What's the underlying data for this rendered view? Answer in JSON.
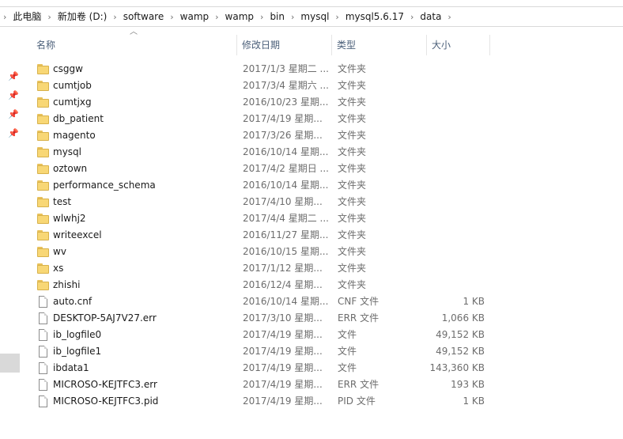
{
  "breadcrumb": [
    "此电脑",
    "新加卷 (D:)",
    "software",
    "wamp",
    "wamp",
    "bin",
    "mysql",
    "mysql5.6.17",
    "data"
  ],
  "columns": {
    "name": "名称",
    "date": "修改日期",
    "type": "类型",
    "size": "大小"
  },
  "files": [
    {
      "name": "csggw",
      "date": "2017/1/3 星期二 ...",
      "type": "文件夹",
      "size": "",
      "kind": "folder"
    },
    {
      "name": "cumtjob",
      "date": "2017/3/4 星期六 ...",
      "type": "文件夹",
      "size": "",
      "kind": "folder"
    },
    {
      "name": "cumtjxg",
      "date": "2016/10/23 星期...",
      "type": "文件夹",
      "size": "",
      "kind": "folder"
    },
    {
      "name": "db_patient",
      "date": "2017/4/19 星期...",
      "type": "文件夹",
      "size": "",
      "kind": "folder"
    },
    {
      "name": "magento",
      "date": "2017/3/26 星期...",
      "type": "文件夹",
      "size": "",
      "kind": "folder"
    },
    {
      "name": "mysql",
      "date": "2016/10/14 星期...",
      "type": "文件夹",
      "size": "",
      "kind": "folder"
    },
    {
      "name": "oztown",
      "date": "2017/4/2 星期日 ...",
      "type": "文件夹",
      "size": "",
      "kind": "folder"
    },
    {
      "name": "performance_schema",
      "date": "2016/10/14 星期...",
      "type": "文件夹",
      "size": "",
      "kind": "folder"
    },
    {
      "name": "test",
      "date": "2017/4/10 星期...",
      "type": "文件夹",
      "size": "",
      "kind": "folder"
    },
    {
      "name": "wlwhj2",
      "date": "2017/4/4 星期二 ...",
      "type": "文件夹",
      "size": "",
      "kind": "folder"
    },
    {
      "name": "writeexcel",
      "date": "2016/11/27 星期...",
      "type": "文件夹",
      "size": "",
      "kind": "folder"
    },
    {
      "name": "wv",
      "date": "2016/10/15 星期...",
      "type": "文件夹",
      "size": "",
      "kind": "folder"
    },
    {
      "name": "xs",
      "date": "2017/1/12 星期...",
      "type": "文件夹",
      "size": "",
      "kind": "folder"
    },
    {
      "name": "zhishi",
      "date": "2016/12/4 星期...",
      "type": "文件夹",
      "size": "",
      "kind": "folder"
    },
    {
      "name": "auto.cnf",
      "date": "2016/10/14 星期...",
      "type": "CNF 文件",
      "size": "1 KB",
      "kind": "file"
    },
    {
      "name": "DESKTOP-5AJ7V27.err",
      "date": "2017/3/10 星期...",
      "type": "ERR 文件",
      "size": "1,066 KB",
      "kind": "file"
    },
    {
      "name": "ib_logfile0",
      "date": "2017/4/19 星期...",
      "type": "文件",
      "size": "49,152 KB",
      "kind": "file"
    },
    {
      "name": "ib_logfile1",
      "date": "2017/4/19 星期...",
      "type": "文件",
      "size": "49,152 KB",
      "kind": "file"
    },
    {
      "name": "ibdata1",
      "date": "2017/4/19 星期...",
      "type": "文件",
      "size": "143,360 KB",
      "kind": "file"
    },
    {
      "name": "MICROSO-KEJTFC3.err",
      "date": "2017/4/19 星期...",
      "type": "ERR 文件",
      "size": "193 KB",
      "kind": "file"
    },
    {
      "name": "MICROSO-KEJTFC3.pid",
      "date": "2017/4/19 星期...",
      "type": "PID 文件",
      "size": "1 KB",
      "kind": "file"
    }
  ],
  "icons": {
    "folder": "folder-icon",
    "file": "file-icon",
    "pin": "pin-icon",
    "separator": "chevron-right-icon",
    "sort": "sort-up-icon"
  },
  "colors": {
    "folder": "#f8d775",
    "header_text": "#4c607a",
    "secondary_text": "#6d6d6d"
  }
}
